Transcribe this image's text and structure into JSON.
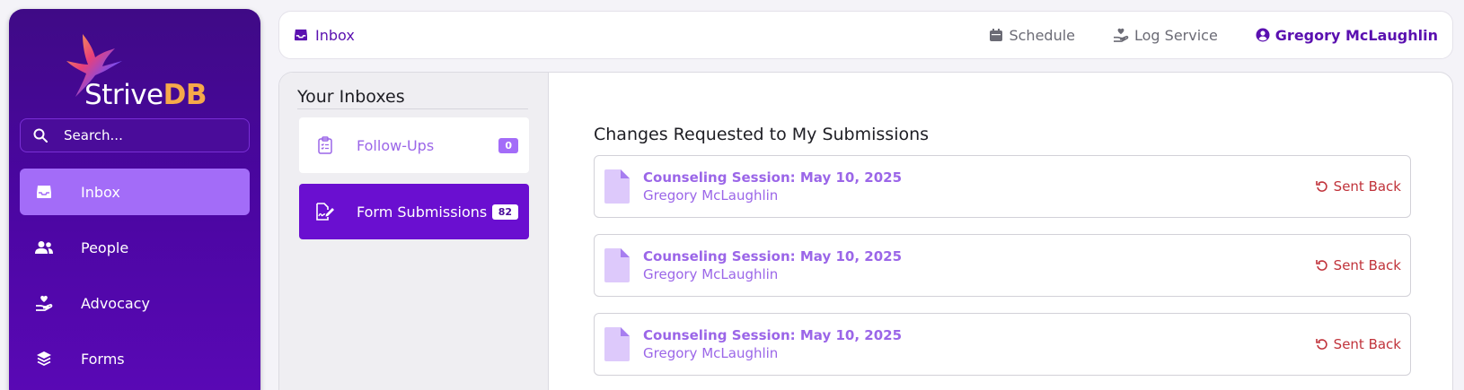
{
  "app": {
    "brand_main": "Strive",
    "brand_accent": "DB"
  },
  "search": {
    "placeholder": "Search..."
  },
  "sidebar": {
    "items": [
      {
        "label": "Inbox",
        "icon": "inbox-icon",
        "active": true
      },
      {
        "label": "People",
        "icon": "people-icon"
      },
      {
        "label": "Advocacy",
        "icon": "hand-heart-icon"
      },
      {
        "label": "Forms",
        "icon": "layers-icon"
      }
    ]
  },
  "topbar": {
    "breadcrumb": "Inbox",
    "schedule": "Schedule",
    "log_service": "Log Service",
    "user": "Gregory McLaughlin"
  },
  "inboxes": {
    "title": "Your Inboxes",
    "items": [
      {
        "label": "Follow-Ups",
        "count": "0"
      },
      {
        "label": "Form Submissions",
        "count": "82"
      }
    ]
  },
  "main": {
    "title": "Changes Requested to My Submissions",
    "submissions": [
      {
        "title": "Counseling Session: May 10, 2025",
        "name": "Gregory McLaughlin",
        "status": "Sent Back"
      },
      {
        "title": "Counseling Session: May 10, 2025",
        "name": "Gregory McLaughlin",
        "status": "Sent Back"
      },
      {
        "title": "Counseling Session: May 10, 2025",
        "name": "Gregory McLaughlin",
        "status": "Sent Back"
      }
    ]
  },
  "colors": {
    "brand_purple": "#5a10b0",
    "sidebar_active": "#a36cf8",
    "sent_back_red": "#c0323a",
    "link_purple": "#9b66e8"
  }
}
